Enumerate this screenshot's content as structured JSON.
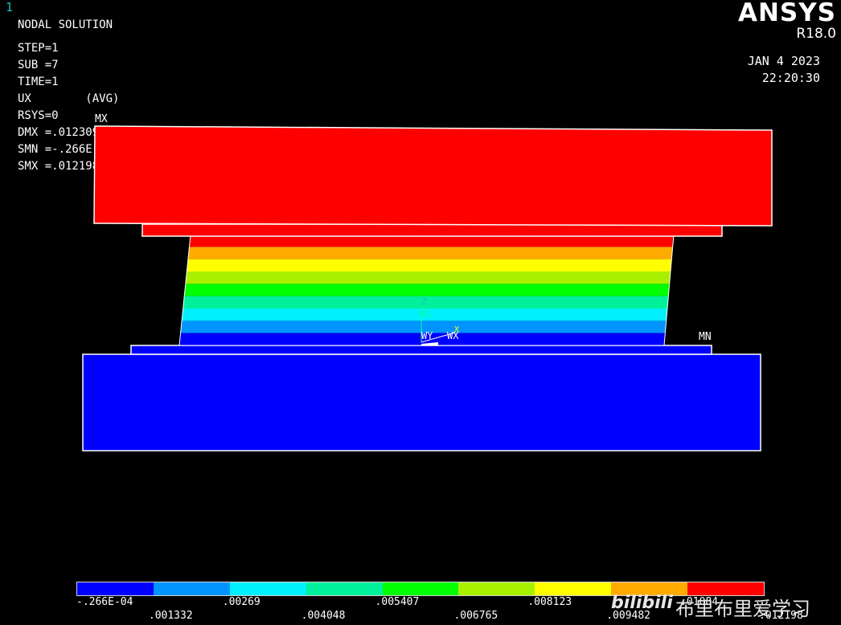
{
  "window": {
    "number": "1"
  },
  "header": {
    "title": "NODAL SOLUTION",
    "step": "STEP=1",
    "sub": "SUB =7",
    "time": "TIME=1",
    "item": "UX        (AVG)",
    "rsys": "RSYS=0",
    "dmx": "DMX =.012309",
    "smn": "SMN =-.266E-04",
    "smx": "SMX =.012198"
  },
  "brand": {
    "logo": "ANSYS",
    "version": "R18.0"
  },
  "datetime": {
    "date": "JAN  4 2023",
    "time": "22:20:30"
  },
  "markers": {
    "max": "MX",
    "min": "MN"
  },
  "triad": {
    "z": "Z",
    "wz": "WZ",
    "wy": "WY",
    "wx": "WX",
    "x": "X"
  },
  "contour_colors": [
    "#0000ff",
    "#0094ff",
    "#00f0ff",
    "#00f09c",
    "#00ff00",
    "#a8f000",
    "#ffff00",
    "#ffaa00",
    "#ff0000"
  ],
  "legend": {
    "top_values": [
      "-.266E-04",
      ".00269",
      ".005407",
      ".008123",
      ".01084"
    ],
    "bottom_values": [
      ".001332",
      ".004048",
      ".006765",
      ".009482",
      ".012198"
    ]
  },
  "watermark": {
    "logo": "bilibili",
    "text": "布里布里爱学习"
  }
}
